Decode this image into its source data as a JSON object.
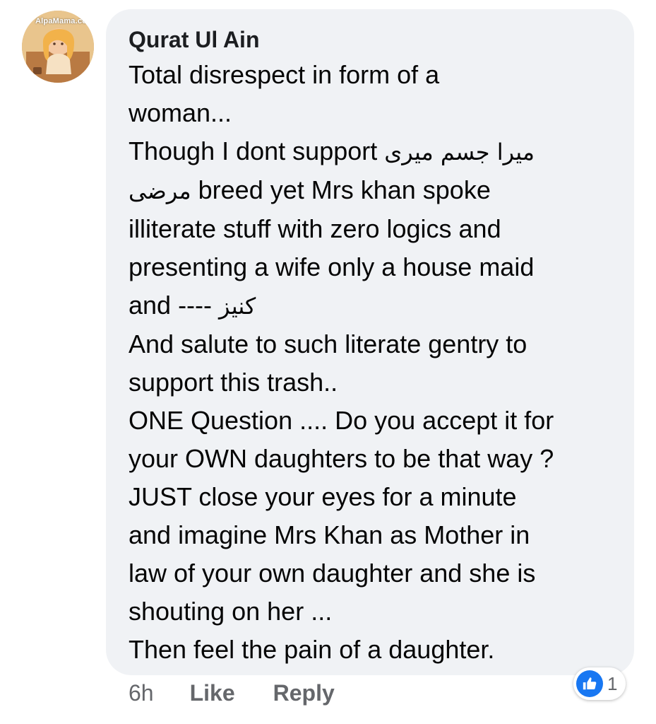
{
  "avatar": {
    "watermark": "AlpaMama.com"
  },
  "comment": {
    "author": "Qurat Ul Ain",
    "lines": [
      {
        "text": "Total disrespect in form of a"
      },
      {
        "text": "woman..."
      },
      {
        "text": "Though I dont support ",
        "urdu": "میرا جسم میری"
      },
      {
        "urdu": "مرضی",
        "text": " breed yet Mrs khan spoke"
      },
      {
        "text": "illiterate stuff with zero logics and"
      },
      {
        "text": "presenting a wife only a house maid"
      },
      {
        "text": "and ---- ",
        "urdu": "کنیز"
      },
      {
        "text": "And salute to such literate  gentry  to"
      },
      {
        "text": "support this trash.."
      },
      {
        "text": "ONE Question .... Do you accept it for"
      },
      {
        "text": "your OWN daughters to be that way ?"
      },
      {
        "text": "JUST close your eyes for a minute"
      },
      {
        "text": "and imagine Mrs Khan as Mother in"
      },
      {
        "text": "law of your own daughter and she is"
      },
      {
        "text": "shouting on her ..."
      },
      {
        "text": "Then feel the pain of a daughter."
      }
    ]
  },
  "actions": {
    "time": "6h",
    "like_label": "Like",
    "reply_label": "Reply"
  },
  "reactions": {
    "icon": "thumbs-up-icon",
    "count": "1",
    "color": "#1877f2"
  },
  "colors": {
    "bubble": "#f0f2f5",
    "text": "#050505",
    "secondary_text": "#65676b"
  }
}
